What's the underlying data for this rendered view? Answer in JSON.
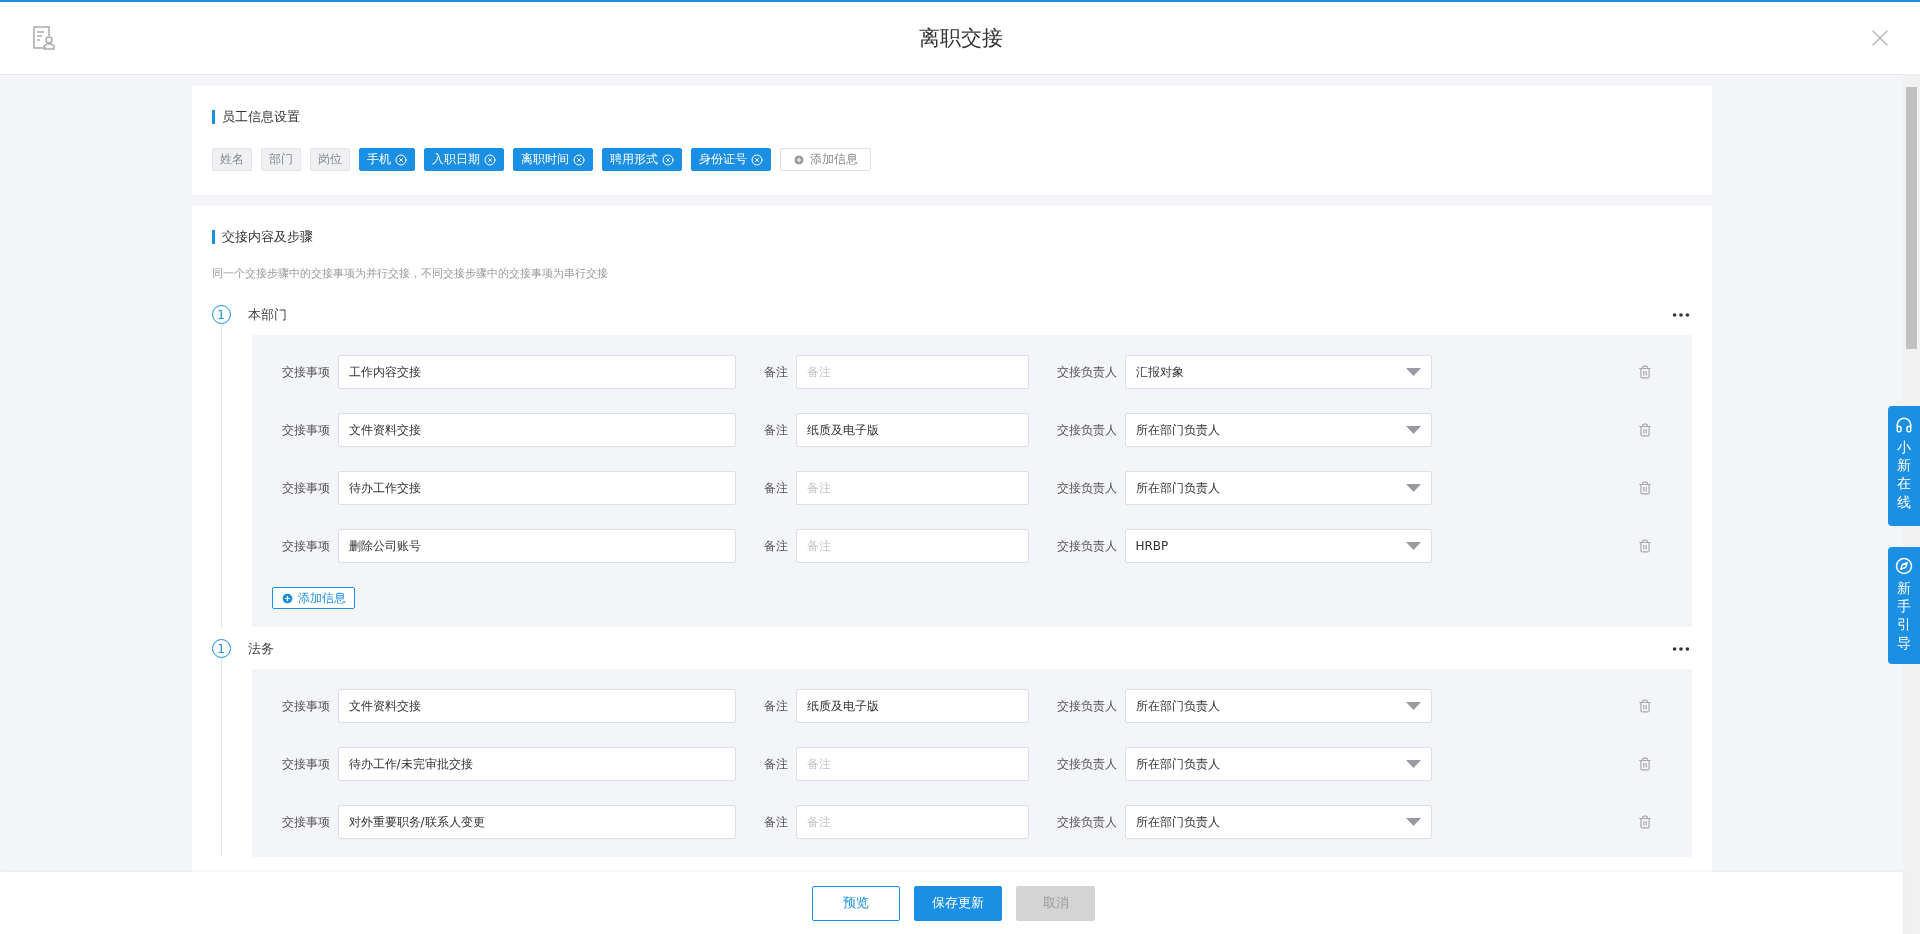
{
  "header": {
    "title": "离职交接"
  },
  "employee_info": {
    "title": "员工信息设置",
    "tags": [
      {
        "label": "姓名",
        "removable": false
      },
      {
        "label": "部门",
        "removable": false
      },
      {
        "label": "岗位",
        "removable": false
      },
      {
        "label": "手机",
        "removable": true
      },
      {
        "label": "入职日期",
        "removable": true
      },
      {
        "label": "离职时间",
        "removable": true
      },
      {
        "label": "聘用形式",
        "removable": true
      },
      {
        "label": "身份证号",
        "removable": true
      }
    ],
    "add_button": "添加信息"
  },
  "handover": {
    "title": "交接内容及步骤",
    "note": "同一个交接步骤中的交接事项为并行交接，不同交接步骤中的交接事项为串行交接",
    "steps": [
      {
        "number": "1",
        "name": "本部门",
        "add_button": "添加信息",
        "items": [
          {
            "item_label": "交接事项",
            "item": "工作内容交接",
            "note_label": "备注",
            "note_placeholder": "备注",
            "owner_label": "交接负责人",
            "owner": "汇报对象"
          },
          {
            "item_label": "交接事项",
            "item": "文件资料交接",
            "note_label": "备注",
            "note": "纸质及电子版",
            "owner_label": "交接负责人",
            "owner": "所在部门负责人"
          },
          {
            "item_label": "交接事项",
            "item": "待办工作交接",
            "note_label": "备注",
            "note_placeholder": "备注",
            "owner_label": "交接负责人",
            "owner": "所在部门负责人"
          },
          {
            "item_label": "交接事项",
            "item": "删除公司账号",
            "note_label": "备注",
            "note_placeholder": "备注",
            "owner_label": "交接负责人",
            "owner": "HRBP"
          }
        ]
      },
      {
        "number": "1",
        "name": "法务",
        "items": [
          {
            "item_label": "交接事项",
            "item": "文件资料交接",
            "note_label": "备注",
            "note": "纸质及电子版",
            "owner_label": "交接负责人",
            "owner": "所在部门负责人"
          },
          {
            "item_label": "交接事项",
            "item": "待办工作/未完审批交接",
            "note_label": "备注",
            "note_placeholder": "备注",
            "owner_label": "交接负责人",
            "owner": "所在部门负责人"
          },
          {
            "item_label": "交接事项",
            "item": "对外重要职务/联系人变更",
            "note_label": "备注",
            "note_placeholder": "备注",
            "owner_label": "交接负责人",
            "owner": "所在部门负责人"
          }
        ]
      }
    ]
  },
  "footer": {
    "buttons": [
      {
        "label": "预览",
        "kind": "outline"
      },
      {
        "label": "保存更新",
        "kind": "primary"
      },
      {
        "label": "取消",
        "kind": "disabled"
      }
    ]
  },
  "side_buttons": [
    {
      "label": "小新在线",
      "kind": "chat"
    },
    {
      "label": "新手引导",
      "kind": "guide"
    }
  ]
}
